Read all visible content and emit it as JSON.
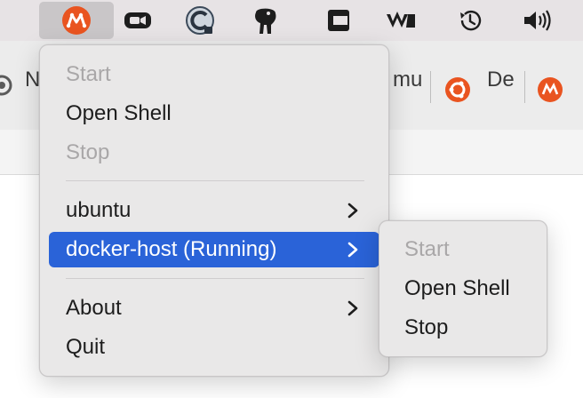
{
  "menubar": {
    "icons": [
      "multipass-icon",
      "zoom-icon",
      "ccleaner-icon",
      "postgres-elephant-icon",
      "codepen-icon",
      "webflow-icon",
      "time-machine-icon",
      "volume-icon"
    ]
  },
  "browser": {
    "tabs": [
      {
        "text": "N"
      },
      {
        "text": "mu"
      },
      {
        "text": "De"
      }
    ]
  },
  "main_menu": {
    "items": [
      {
        "label": "Start",
        "enabled": false
      },
      {
        "label": "Open Shell",
        "enabled": true
      },
      {
        "label": "Stop",
        "enabled": false
      },
      {
        "label": "ubuntu",
        "enabled": true,
        "submenu": true
      },
      {
        "label": "docker-host (Running)",
        "enabled": true,
        "submenu": true,
        "highlighted": true
      },
      {
        "label": "About",
        "enabled": true,
        "submenu": true
      },
      {
        "label": "Quit",
        "enabled": true
      }
    ]
  },
  "sub_menu": {
    "items": [
      {
        "label": "Start",
        "enabled": false
      },
      {
        "label": "Open Shell",
        "enabled": true
      },
      {
        "label": "Stop",
        "enabled": true
      }
    ]
  },
  "colors": {
    "highlight": "#2a63d8",
    "multipass_orange": "#e95420",
    "disabled_text": "#a9a7a8"
  }
}
